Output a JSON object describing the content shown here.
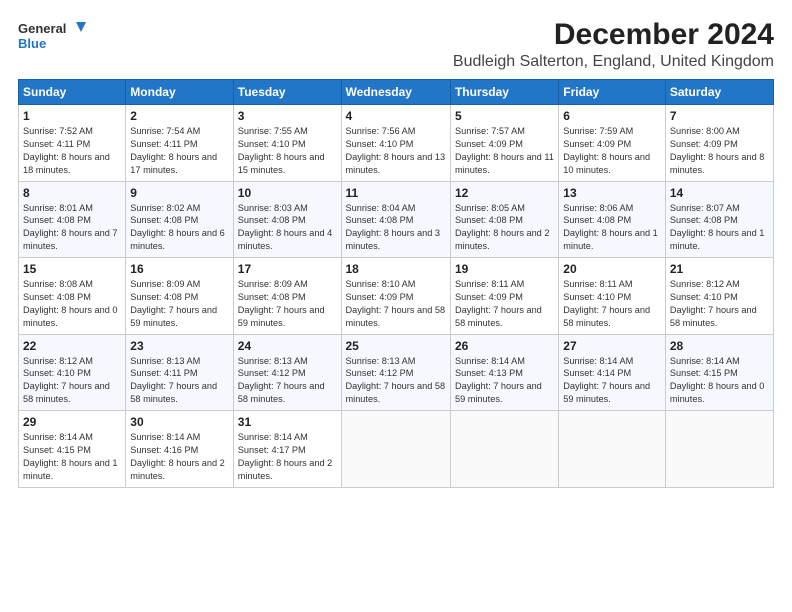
{
  "header": {
    "logo": {
      "general": "General",
      "blue": "Blue"
    },
    "title": "December 2024",
    "subtitle": "Budleigh Salterton, England, United Kingdom"
  },
  "calendar": {
    "days_of_week": [
      "Sunday",
      "Monday",
      "Tuesday",
      "Wednesday",
      "Thursday",
      "Friday",
      "Saturday"
    ],
    "weeks": [
      [
        null,
        {
          "day": "2",
          "sunrise": "7:54 AM",
          "sunset": "4:11 PM",
          "daylight": "8 hours and 17 minutes."
        },
        {
          "day": "3",
          "sunrise": "7:55 AM",
          "sunset": "4:10 PM",
          "daylight": "8 hours and 15 minutes."
        },
        {
          "day": "4",
          "sunrise": "7:56 AM",
          "sunset": "4:10 PM",
          "daylight": "8 hours and 13 minutes."
        },
        {
          "day": "5",
          "sunrise": "7:57 AM",
          "sunset": "4:09 PM",
          "daylight": "8 hours and 11 minutes."
        },
        {
          "day": "6",
          "sunrise": "7:59 AM",
          "sunset": "4:09 PM",
          "daylight": "8 hours and 10 minutes."
        },
        {
          "day": "7",
          "sunrise": "8:00 AM",
          "sunset": "4:09 PM",
          "daylight": "8 hours and 8 minutes."
        }
      ],
      [
        {
          "day": "1",
          "sunrise": "7:52 AM",
          "sunset": "4:11 PM",
          "daylight": "8 hours and 18 minutes."
        },
        {
          "day": "9",
          "sunrise": "8:02 AM",
          "sunset": "4:08 PM",
          "daylight": "8 hours and 6 minutes."
        },
        {
          "day": "10",
          "sunrise": "8:03 AM",
          "sunset": "4:08 PM",
          "daylight": "8 hours and 4 minutes."
        },
        {
          "day": "11",
          "sunrise": "8:04 AM",
          "sunset": "4:08 PM",
          "daylight": "8 hours and 3 minutes."
        },
        {
          "day": "12",
          "sunrise": "8:05 AM",
          "sunset": "4:08 PM",
          "daylight": "8 hours and 2 minutes."
        },
        {
          "day": "13",
          "sunrise": "8:06 AM",
          "sunset": "4:08 PM",
          "daylight": "8 hours and 1 minute."
        },
        {
          "day": "14",
          "sunrise": "8:07 AM",
          "sunset": "4:08 PM",
          "daylight": "8 hours and 1 minute."
        }
      ],
      [
        {
          "day": "8",
          "sunrise": "8:01 AM",
          "sunset": "4:08 PM",
          "daylight": "8 hours and 7 minutes."
        },
        {
          "day": "16",
          "sunrise": "8:09 AM",
          "sunset": "4:08 PM",
          "daylight": "7 hours and 59 minutes."
        },
        {
          "day": "17",
          "sunrise": "8:09 AM",
          "sunset": "4:08 PM",
          "daylight": "7 hours and 59 minutes."
        },
        {
          "day": "18",
          "sunrise": "8:10 AM",
          "sunset": "4:09 PM",
          "daylight": "7 hours and 58 minutes."
        },
        {
          "day": "19",
          "sunrise": "8:11 AM",
          "sunset": "4:09 PM",
          "daylight": "7 hours and 58 minutes."
        },
        {
          "day": "20",
          "sunrise": "8:11 AM",
          "sunset": "4:10 PM",
          "daylight": "7 hours and 58 minutes."
        },
        {
          "day": "21",
          "sunrise": "8:12 AM",
          "sunset": "4:10 PM",
          "daylight": "7 hours and 58 minutes."
        }
      ],
      [
        {
          "day": "15",
          "sunrise": "8:08 AM",
          "sunset": "4:08 PM",
          "daylight": "8 hours and 0 minutes."
        },
        {
          "day": "23",
          "sunrise": "8:13 AM",
          "sunset": "4:11 PM",
          "daylight": "7 hours and 58 minutes."
        },
        {
          "day": "24",
          "sunrise": "8:13 AM",
          "sunset": "4:12 PM",
          "daylight": "7 hours and 58 minutes."
        },
        {
          "day": "25",
          "sunrise": "8:13 AM",
          "sunset": "4:12 PM",
          "daylight": "7 hours and 58 minutes."
        },
        {
          "day": "26",
          "sunrise": "8:14 AM",
          "sunset": "4:13 PM",
          "daylight": "7 hours and 59 minutes."
        },
        {
          "day": "27",
          "sunrise": "8:14 AM",
          "sunset": "4:14 PM",
          "daylight": "7 hours and 59 minutes."
        },
        {
          "day": "28",
          "sunrise": "8:14 AM",
          "sunset": "4:15 PM",
          "daylight": "8 hours and 0 minutes."
        }
      ],
      [
        {
          "day": "22",
          "sunrise": "8:12 AM",
          "sunset": "4:10 PM",
          "daylight": "7 hours and 58 minutes."
        },
        {
          "day": "30",
          "sunrise": "8:14 AM",
          "sunset": "4:16 PM",
          "daylight": "8 hours and 2 minutes."
        },
        {
          "day": "31",
          "sunrise": "8:14 AM",
          "sunset": "4:17 PM",
          "daylight": "8 hours and 2 minutes."
        },
        null,
        null,
        null,
        null
      ],
      [
        {
          "day": "29",
          "sunrise": "8:14 AM",
          "sunset": "4:15 PM",
          "daylight": "8 hours and 1 minute."
        },
        null,
        null,
        null,
        null,
        null,
        null
      ]
    ],
    "week_starts": [
      [
        1,
        2,
        3,
        4,
        5,
        6,
        7
      ],
      [
        8,
        9,
        10,
        11,
        12,
        13,
        14
      ],
      [
        15,
        16,
        17,
        18,
        19,
        20,
        21
      ],
      [
        22,
        23,
        24,
        25,
        26,
        27,
        28
      ],
      [
        29,
        30,
        31
      ]
    ]
  },
  "labels": {
    "sunrise": "Sunrise: ",
    "sunset": "Sunset: ",
    "daylight": "Daylight: "
  }
}
